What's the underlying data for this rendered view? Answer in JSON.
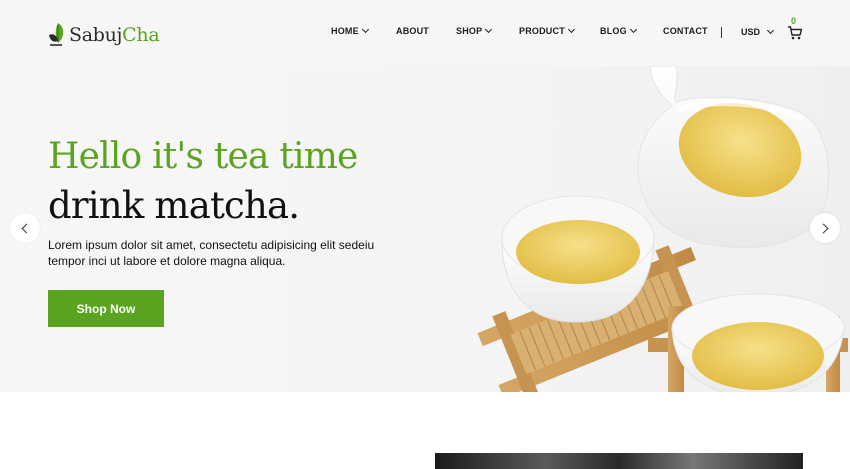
{
  "brand": {
    "name_part1": "Sabuj",
    "name_part2": "Cha"
  },
  "nav": {
    "items": [
      {
        "label": "HOME",
        "has_dropdown": true
      },
      {
        "label": "ABOUT",
        "has_dropdown": false
      },
      {
        "label": "SHOP",
        "has_dropdown": true
      },
      {
        "label": "PRODUCT",
        "has_dropdown": true
      },
      {
        "label": "BLOG",
        "has_dropdown": true
      },
      {
        "label": "CONTACT",
        "has_dropdown": false
      }
    ],
    "currency": "USD",
    "cart_count": "0"
  },
  "hero": {
    "title_line1": "Hello it's tea time",
    "title_line2": "drink matcha.",
    "description": "Lorem ipsum dolor sit amet, consectetu adipisicing elit sedeiu tempor inci ut labore et dolore magna aliqua.",
    "cta_label": "Shop Now"
  },
  "icons": {
    "logo": "tea-leaf-icon",
    "cart": "shopping-cart-icon",
    "prev": "chevron-left-icon",
    "next": "chevron-right-icon",
    "dropdown": "chevron-down-icon"
  },
  "colors": {
    "accent": "#5aa41f",
    "text": "#111111",
    "header_bg": "#f6f6f6",
    "hero_bg": "#f4f4f4"
  }
}
